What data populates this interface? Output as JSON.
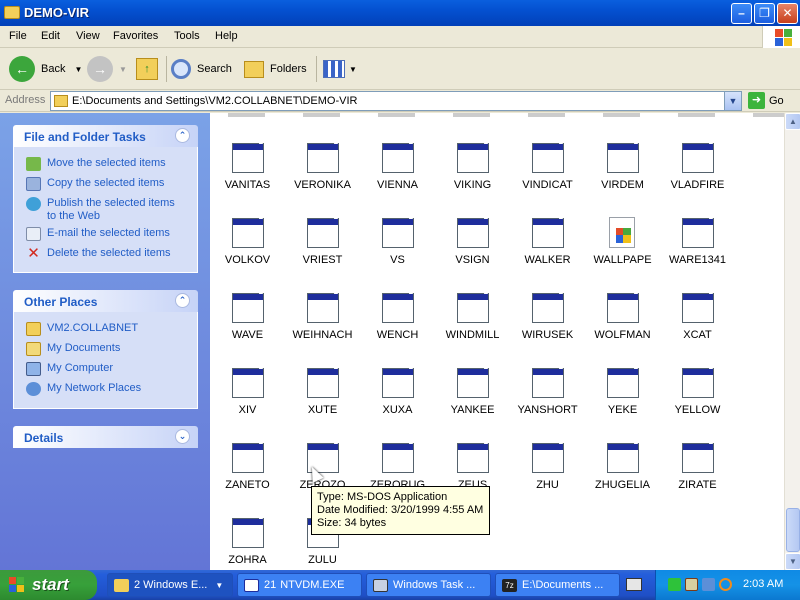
{
  "window": {
    "title": "DEMO-VIR"
  },
  "menu": [
    "File",
    "Edit",
    "View",
    "Favorites",
    "Tools",
    "Help"
  ],
  "toolbar": {
    "back_label": "Back",
    "search_label": "Search",
    "folders_label": "Folders"
  },
  "address": {
    "label": "Address",
    "path": "E:\\Documents and Settings\\VM2.COLLABNET\\DEMO-VIR",
    "go_label": "Go"
  },
  "tasks_panel": {
    "title": "File and Folder Tasks",
    "items": [
      "Move the selected items",
      "Copy the selected items",
      "Publish the selected items to the Web",
      "E-mail the selected items",
      "Delete the selected items"
    ]
  },
  "places_panel": {
    "title": "Other Places",
    "items": [
      "VM2.COLLABNET",
      "My Documents",
      "My Computer",
      "My Network Places"
    ]
  },
  "details_panel": {
    "title": "Details"
  },
  "files": [
    "VANITAS",
    "VERONIKA",
    "VIENNA",
    "VIKING",
    "VINDICAT",
    "VIRDEM",
    "VLADFIRE",
    "VOLKOV",
    "VRIEST",
    "VS",
    "VSIGN",
    "WALKER",
    "WALLPAPE",
    "WARE1341",
    "WAVE",
    "WEIHNACH",
    "WENCH",
    "WINDMILL",
    "WIRUSEK",
    "WOLFMAN",
    "XCAT",
    "XIV",
    "XUTE",
    "XUXA",
    "YANKEE",
    "YANSHORT",
    "YEKE",
    "YELLOW",
    "ZANETO",
    "ZEROZO",
    "ZERORUG",
    "ZEUS",
    "ZHU",
    "ZHUGELIA",
    "ZIRATE",
    "ZOHRA",
    "ZULU"
  ],
  "tooltip": {
    "type": "Type: MS-DOS Application",
    "date": "Date Modified: 3/20/1999 4:55 AM",
    "size": "Size: 34 bytes"
  },
  "taskbar": {
    "start_label": "start",
    "tasks": [
      "2 Windows E...",
      "NTVDM.EXE",
      "Windows Task ...",
      "E:\\Documents ..."
    ],
    "task_count": "21",
    "clock": "2:03 AM"
  }
}
